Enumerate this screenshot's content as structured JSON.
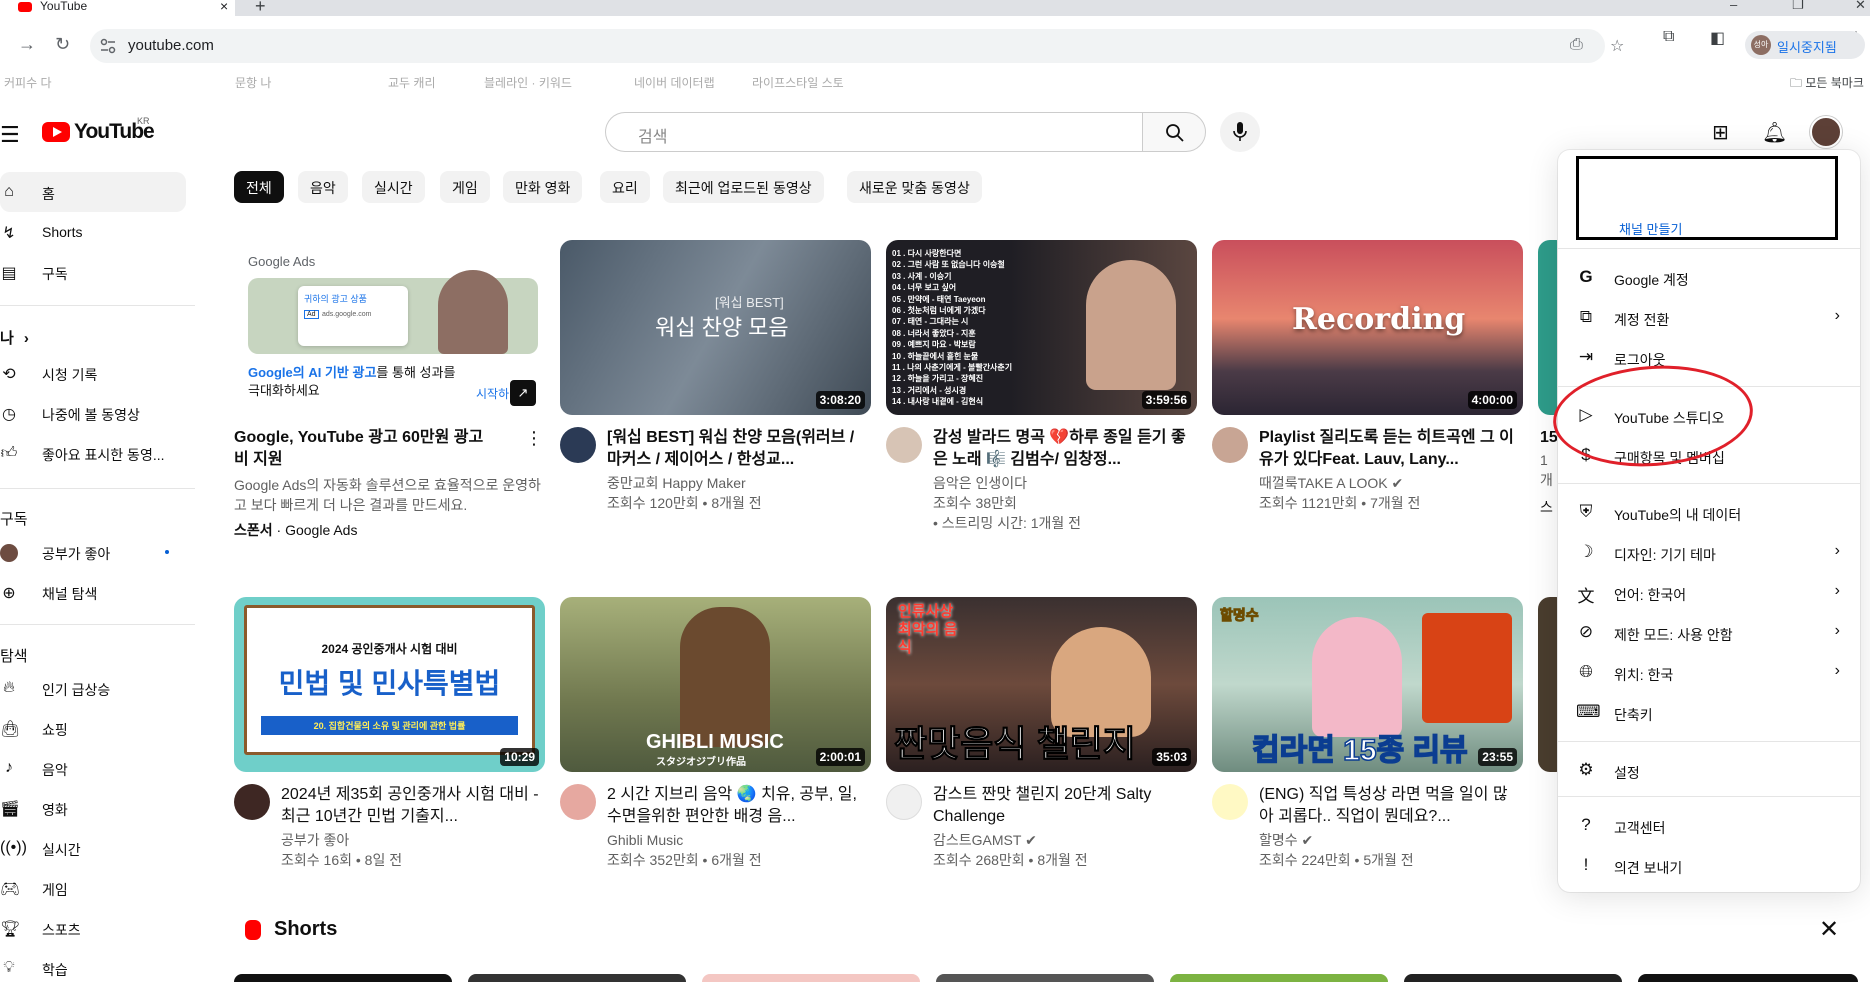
{
  "browser": {
    "tab_title": "YouTube",
    "url": "youtube.com",
    "profile_label": "일시중지됨",
    "profile_initials": "성아",
    "bookmarks": [
      "커피수 다",
      "문항 나",
      "교두 캐리",
      "블레라인 · 키워드",
      "네이버 데이터랩",
      "라이프스타일 스토",
      "모든 북마크"
    ]
  },
  "header": {
    "logo_text": "YouTube",
    "region": "KR",
    "search_placeholder": "검색"
  },
  "sidebar": {
    "items": [
      {
        "label": "홈",
        "icon": "home-icon"
      },
      {
        "label": "Shorts",
        "icon": "shorts-icon"
      },
      {
        "label": "구독",
        "icon": "subscriptions-icon"
      }
    ],
    "you_label": "나",
    "you_items": [
      {
        "label": "시청 기록",
        "icon": "history-icon"
      },
      {
        "label": "나중에 볼 동영상",
        "icon": "watch-later-icon"
      },
      {
        "label": "좋아요 표시한 동영...",
        "icon": "like-icon"
      }
    ],
    "subs_label": "구독",
    "subs_items": [
      {
        "label": "공부가 좋아",
        "icon": "channel-avatar"
      },
      {
        "label": "채널 탐색",
        "icon": "add-circle-icon"
      }
    ],
    "explore_label": "탐색",
    "explore_items": [
      {
        "label": "인기 급상승",
        "icon": "trending-icon"
      },
      {
        "label": "쇼핑",
        "icon": "shopping-icon"
      },
      {
        "label": "음악",
        "icon": "music-icon"
      },
      {
        "label": "영화",
        "icon": "movie-icon"
      },
      {
        "label": "실시간",
        "icon": "live-icon"
      },
      {
        "label": "게임",
        "icon": "gaming-icon"
      },
      {
        "label": "스포츠",
        "icon": "sports-icon"
      },
      {
        "label": "학습",
        "icon": "learning-icon"
      }
    ]
  },
  "chips": [
    "전체",
    "음악",
    "실시간",
    "게임",
    "만화 영화",
    "요리",
    "최근에 업로드된 동영상",
    "새로운 맞춤 동영상"
  ],
  "ad": {
    "brand": "Google Ads",
    "card_title": "귀하의 광고 상품",
    "card_url": "ads.google.com",
    "headline_blue": "Google의 AI 기반 광고",
    "headline_rest": "를 통해 성과를 극대화하세요",
    "cta": "시작하",
    "title": "Google, YouTube 광고 60만원 광고비 지원",
    "desc": "Google Ads의 자동화 솔루션으로 효율적으로 운영하고 보다 빠르게 더 나은 결과를 만드세요.",
    "sponsor": "스폰서 · Google Ads"
  },
  "videos": [
    {
      "title": "[워십 BEST] 워십 찬양 모음(위러브 / 마커스 / 제이어스 / 한성교...",
      "channel": "중만교회 Happy Maker",
      "meta": "조회수 120만회 • 8개월 전",
      "duration": "3:08:20",
      "thumb_text": "워십 찬양 모음",
      "thumb_sub": "[워십 BEST]"
    },
    {
      "title": "감성 발라드 명곡 💔하루 종일 듣기 좋은 노래 🎼 김범수/ 임창정...",
      "channel": "음악은 인생이다",
      "meta": "조회수 38만회",
      "meta2": "• 스트리밍 시간: 1개월 전",
      "duration": "3:59:56",
      "tracklist": [
        "01 . 다시 사랑한다면",
        "02 . 그런 사람 또 없습니다 이승철",
        "03 . 사계 - 이승기",
        "04 . 너무 보고 싶어",
        "05 . 만약에 - 태연 Taeyeon",
        "06 . 첫눈처럼 너에게 가겠다",
        "07 . 태연 - 그대라는 시",
        "08 . 너라서 좋았다 - 지훈",
        "09 . 예쁘지 마요 - 박보람",
        "10 . 하늘끝에서 흩힌 눈물",
        "11 . 나의 사춘기에게 - 볼빨간사춘기",
        "12 . 하늘을 가리고 - 장혜진",
        "13 . 거리에서 - 성시경",
        "14 . 내사랑 내곁에 - 김현식"
      ]
    },
    {
      "title": "Playlist 질리도록 듣는 히트곡엔 그 이유가 있다Feat. Lauv, Lany...",
      "channel": "때껄룩TAKE A LOOK",
      "meta": "조회수 1121만회 • 7개월 전",
      "duration": "4:00:00",
      "thumb_text": "Recording"
    },
    {
      "title": "15",
      "meta_a": "1",
      "meta_b": "개",
      "meta_c": "스"
    },
    {
      "title": "2024년 제35회 공인중개사 시험 대비 - 최근 10년간 민법 기출지...",
      "channel": "공부가 좋아",
      "meta": "조회수 16회 • 8일 전",
      "duration": "10:29",
      "thumb_top": "2024 공인중개사 시험 대비",
      "thumb_text": "민법 및 민사특별법",
      "thumb_sub": "20. 집합건물의 소유 및 관리에 관한 법률"
    },
    {
      "title": "2 시간 지브리 음악 🌏 치유, 공부, 일, 수면을위한 편안한 배경 음...",
      "channel": "Ghibli Music",
      "meta": "조회수 352만회 • 6개월 전",
      "duration": "2:00:01",
      "thumb_text": "GHIBLI MUSIC",
      "thumb_sub": "スタジオジブリ作品"
    },
    {
      "title": "감스트 짠맛 챌린지 20단계 Salty Challenge",
      "channel": "감스트GAMST",
      "meta": "조회수 268만회 • 8개월 전",
      "duration": "35:03",
      "thumb_text": "짠맛음식 챌린지",
      "thumb_top": "인류사상 최악의 음식"
    },
    {
      "title": "(ENG) 직업 특성상 라면 먹을 일이 많아 괴롭다.. 직업이 뭔데요?...",
      "channel": "할명수",
      "meta": "조회수 224만회 • 5개월 전",
      "duration": "23:55",
      "thumb_text": "컵라면 15종 리뷰",
      "thumb_top": "할명수"
    }
  ],
  "shorts": {
    "label": "Shorts"
  },
  "dropdown": {
    "create_channel": "채널 만들기",
    "items": [
      {
        "label": "Google 계정",
        "icon": "google-icon",
        "chevron": false
      },
      {
        "label": "계정 전환",
        "icon": "switch-account-icon",
        "chevron": true
      },
      {
        "label": "로그아웃",
        "icon": "sign-out-icon",
        "chevron": false
      },
      {
        "label": "YouTube 스튜디오",
        "icon": "studio-icon",
        "chevron": false
      },
      {
        "label": "구매항목 및 멤버십",
        "icon": "dollar-icon",
        "chevron": false
      },
      {
        "label": "YouTube의 내 데이터",
        "icon": "shield-icon",
        "chevron": false
      },
      {
        "label": "디자인: 기기 테마",
        "icon": "moon-icon",
        "chevron": true
      },
      {
        "label": "언어: 한국어",
        "icon": "translate-icon",
        "chevron": true
      },
      {
        "label": "제한 모드: 사용 안함",
        "icon": "restricted-icon",
        "chevron": true
      },
      {
        "label": "위치: 한국",
        "icon": "globe-icon",
        "chevron": true
      },
      {
        "label": "단축키",
        "icon": "keyboard-icon",
        "chevron": false
      },
      {
        "label": "설정",
        "icon": "settings-icon",
        "chevron": false
      },
      {
        "label": "고객센터",
        "icon": "help-icon",
        "chevron": false
      },
      {
        "label": "의견 보내기",
        "icon": "feedback-icon",
        "chevron": false
      }
    ]
  },
  "colors": {
    "yt_red": "#ff0000",
    "annotation_red": "#e0202a",
    "link_blue": "#065fd4"
  }
}
